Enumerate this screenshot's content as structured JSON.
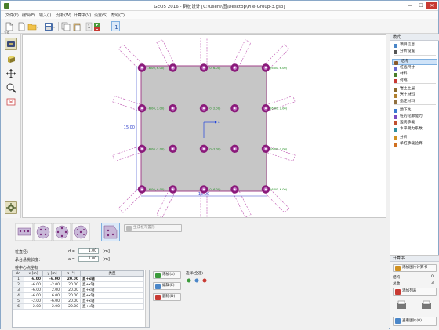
{
  "window": {
    "title": "GEO5 2016 - 群桩设计 [C:\\Users\\图\\Desktop\\Pile-Group-3.gsp]",
    "minimize": "—",
    "maximize": "☐",
    "close": "✕"
  },
  "menu": [
    "文件(F)",
    "编辑(E)",
    "输入(I)",
    "分析(W)",
    "计算书(V)",
    "设置(S)",
    "帮助(T)"
  ],
  "toolbar": {
    "file_caption": "文件",
    "num_label": "1",
    "num_value": "1"
  },
  "left_tools": [
    "view-stage-icon",
    "3d-view-icon",
    "move-icon",
    "zoom-icon",
    "fit-all-icon",
    "settings-icon"
  ],
  "canvas": {
    "dim_width_label": "15.00",
    "dim_height_label": "15.00",
    "axis_x_label": "x",
    "pile_labels": [
      [
        "(0, 6.00)",
        "(6.00, 6.00)"
      ],
      [
        "(0, 2.00)",
        "(6.00, 2.00)"
      ],
      [
        "(0,-2.00)",
        "(6.00,-2.00)"
      ],
      [
        "(0,-6.00)",
        "(6.00,-6.00)"
      ]
    ],
    "row_left_labels": [
      "(-6.00, 6.00)",
      "(-6.00, 2.00)",
      "(-6.00,-2.00)",
      "(-6.00,-6.00)"
    ]
  },
  "right_panel": {
    "header": "模式",
    "items": [
      {
        "label": "项目信息",
        "icon_color": "#4a86c8"
      },
      {
        "label": "分析设置",
        "icon_color": "#555555"
      },
      {
        "label": "结构",
        "icon_color": "#8a5a2a",
        "selected": true
      },
      {
        "label": "桩截尺寸",
        "icon_color": "#6a6ad0"
      },
      {
        "label": "材料",
        "icon_color": "#4a7f2a"
      },
      {
        "label": "荷载",
        "icon_color": "#c83a33"
      },
      {
        "label": "岩土土层",
        "icon_color": "#8a6a2a"
      },
      {
        "label": "岩土材料",
        "icon_color": "#b08030"
      },
      {
        "label": "指定材料",
        "icon_color": "#907040"
      },
      {
        "label": "地下水",
        "icon_color": "#3a7ad0"
      },
      {
        "label": "桩的轮廓能力",
        "icon_color": "#7a4ac0"
      },
      {
        "label": "竖向承载",
        "icon_color": "#c05030"
      },
      {
        "label": "水平受力系数",
        "icon_color": "#3090a0"
      },
      {
        "label": "分析",
        "icon_color": "#d09020"
      },
      {
        "label": "单桩承载验算",
        "icon_color": "#d07020"
      }
    ]
  },
  "calc_panel": {
    "header": "计算书",
    "add_button": "添加图片计算书",
    "rows": [
      {
        "label": "结构：",
        "value": "0"
      },
      {
        "label": "总数：",
        "value": "3"
      }
    ],
    "list_button": "添加列表",
    "view_button": "查看图片(0)"
  },
  "bottom": {
    "spacing_label": "桩直径：",
    "spacing_symbol": "d =",
    "spacing_value": "1.00",
    "spacing_unit": "[m]",
    "overhang_label": "承台悬挑长度：",
    "overhang_symbol": "a =",
    "overhang_value": "1.00",
    "overhang_unit": "[m]",
    "table_caption": "桩中心点坐标",
    "generate_button": "生成桩布置形",
    "columns": [
      "No.",
      "x [m]",
      "y [m]",
      "α [°]",
      "类型"
    ],
    "rows": [
      [
        "1",
        "-6.00",
        "-6.00",
        "20.00",
        "直+x轴"
      ],
      [
        "2",
        "-6.00",
        "-2.00",
        "20.00",
        "直+x轴"
      ],
      [
        "3",
        "-6.00",
        "2.00",
        "20.00",
        "直+x轴"
      ],
      [
        "4",
        "-6.00",
        "6.00",
        "20.00",
        "直+x轴"
      ],
      [
        "5",
        "-2.00",
        "-6.00",
        "20.00",
        "直+x轴"
      ],
      [
        "6",
        "-2.00",
        "-2.00",
        "20.00",
        "直+x轴"
      ]
    ],
    "add_button": "添加(A)",
    "edit_button": "编辑(E)",
    "delete_button": "删除(D)",
    "select_label": "选择(全选)"
  }
}
